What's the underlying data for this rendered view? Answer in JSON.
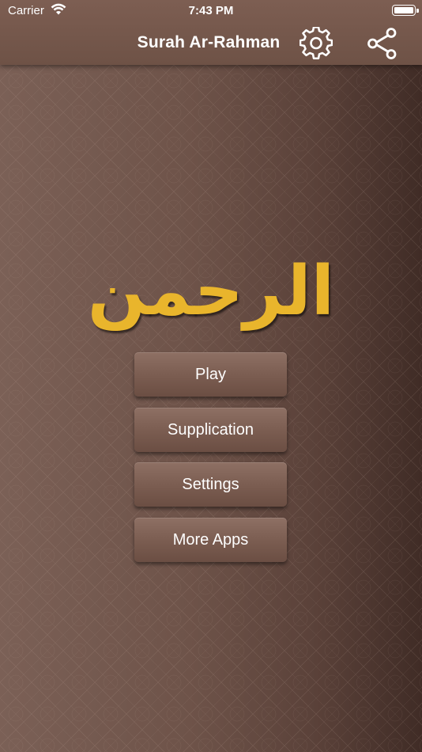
{
  "status_bar": {
    "carrier": "Carrier",
    "time": "7:43 PM",
    "icons": [
      "wifi-icon",
      "battery-icon"
    ]
  },
  "nav_bar": {
    "title": "Surah Ar-Rahman",
    "icons": [
      "gear-icon",
      "share-icon"
    ]
  },
  "logo": {
    "arabic_text": "الرحمن",
    "color": "#e9b52c"
  },
  "menu": {
    "items": [
      {
        "label": "Play"
      },
      {
        "label": "Supplication"
      },
      {
        "label": "Settings"
      },
      {
        "label": "More Apps"
      }
    ]
  },
  "colors": {
    "bar": "#7d5e52",
    "background": "#6e5349",
    "button": "#7a5c50",
    "text": "#ffffff"
  }
}
